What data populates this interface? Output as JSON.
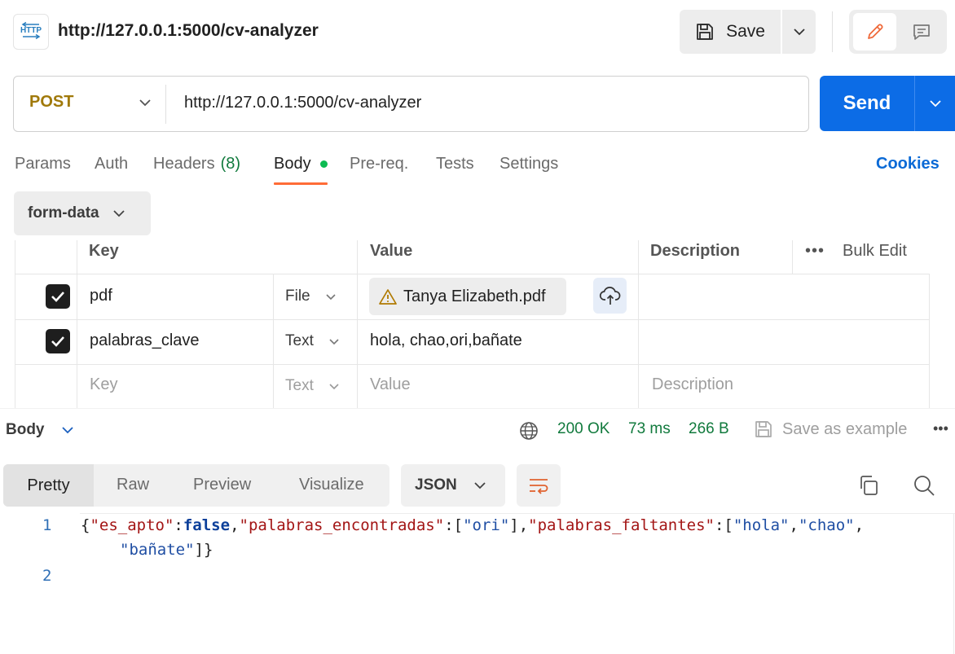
{
  "header": {
    "http_icon_text": "HTTP",
    "title": "http://127.0.0.1:5000/cv-analyzer",
    "save_label": "Save"
  },
  "request": {
    "method": "POST",
    "url": "http://127.0.0.1:5000/cv-analyzer",
    "send_label": "Send",
    "method_color": "#a0790a",
    "send_color": "#0c6ce6"
  },
  "tabs": {
    "params": "Params",
    "auth": "Auth",
    "headers": "Headers",
    "headers_count": "(8)",
    "body": "Body",
    "prereq": "Pre-req.",
    "tests": "Tests",
    "settings": "Settings",
    "cookies": "Cookies",
    "active": "Body",
    "accent": "#ff6c37"
  },
  "body": {
    "mode": "form-data",
    "columns": {
      "key": "Key",
      "value": "Value",
      "description": "Description",
      "bulk_edit": "Bulk Edit"
    },
    "rows": [
      {
        "checked": true,
        "key": "pdf",
        "type": "File",
        "value": "Tanya Elizabeth.pdf",
        "value_icon": "warning-icon"
      },
      {
        "checked": true,
        "key": "palabras_clave",
        "type": "Text",
        "value": "hola, chao,ori,bañate"
      }
    ],
    "empty_row": {
      "key_placeholder": "Key",
      "type": "Text",
      "value_placeholder": "Value",
      "description_placeholder": "Description"
    }
  },
  "response": {
    "section_label": "Body",
    "status": "200 OK",
    "time": "73 ms",
    "size": "266 B",
    "save_example": "Save as example",
    "status_color": "#117a3d",
    "views": {
      "pretty": "Pretty",
      "raw": "Raw",
      "preview": "Preview",
      "visualize": "Visualize",
      "active": "Pretty"
    },
    "language": "JSON",
    "code": {
      "line_numbers": [
        "1",
        "2"
      ],
      "brace_open": "{",
      "k1": "\"es_apto\"",
      "colon1": ":",
      "v1": "false",
      "comma1": ",",
      "k2": "\"palabras_encontradas\"",
      "colon2": ":[",
      "v2": "\"ori\"",
      "close2": "],",
      "k3": "\"palabras_faltantes\"",
      "colon3": ":[",
      "v3a": "\"hola\"",
      "comma3a": ",",
      "v3b": "\"chao\"",
      "comma3b": ",",
      "v3c": "\"bañate\"",
      "close3": "]}"
    }
  }
}
